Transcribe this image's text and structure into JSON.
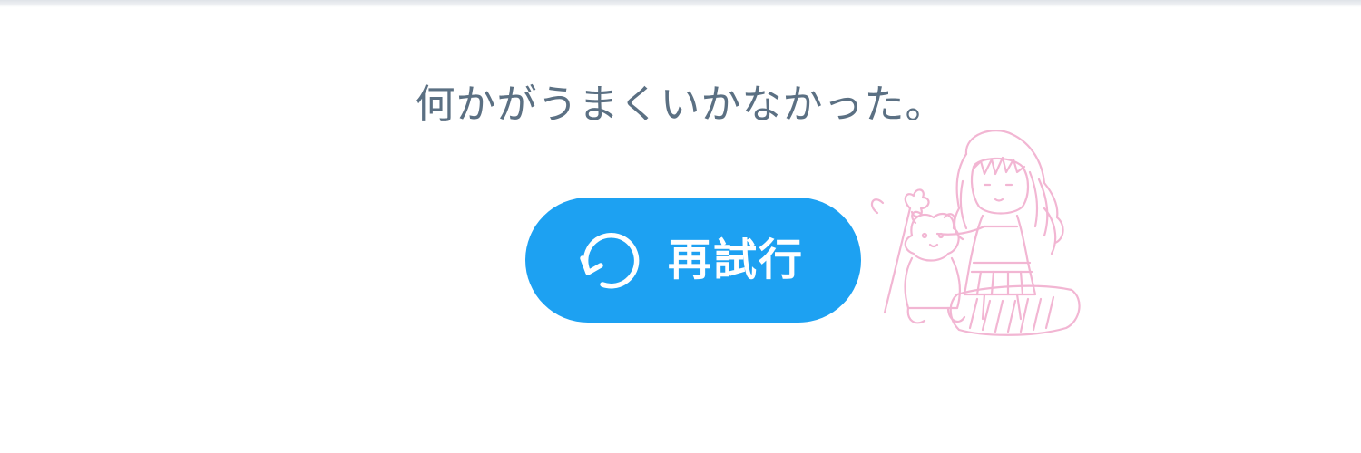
{
  "error": {
    "message": "何かがうまくいかなかった。"
  },
  "retry_button": {
    "label": "再試行",
    "icon": "refresh-icon",
    "background_color": "#1da1f2",
    "text_color": "#ffffff"
  },
  "message_color": "#5b7083",
  "decoration": {
    "icon": "anime-girl-with-teddy-bear-sticker",
    "stroke_color": "#f2b6d3"
  }
}
